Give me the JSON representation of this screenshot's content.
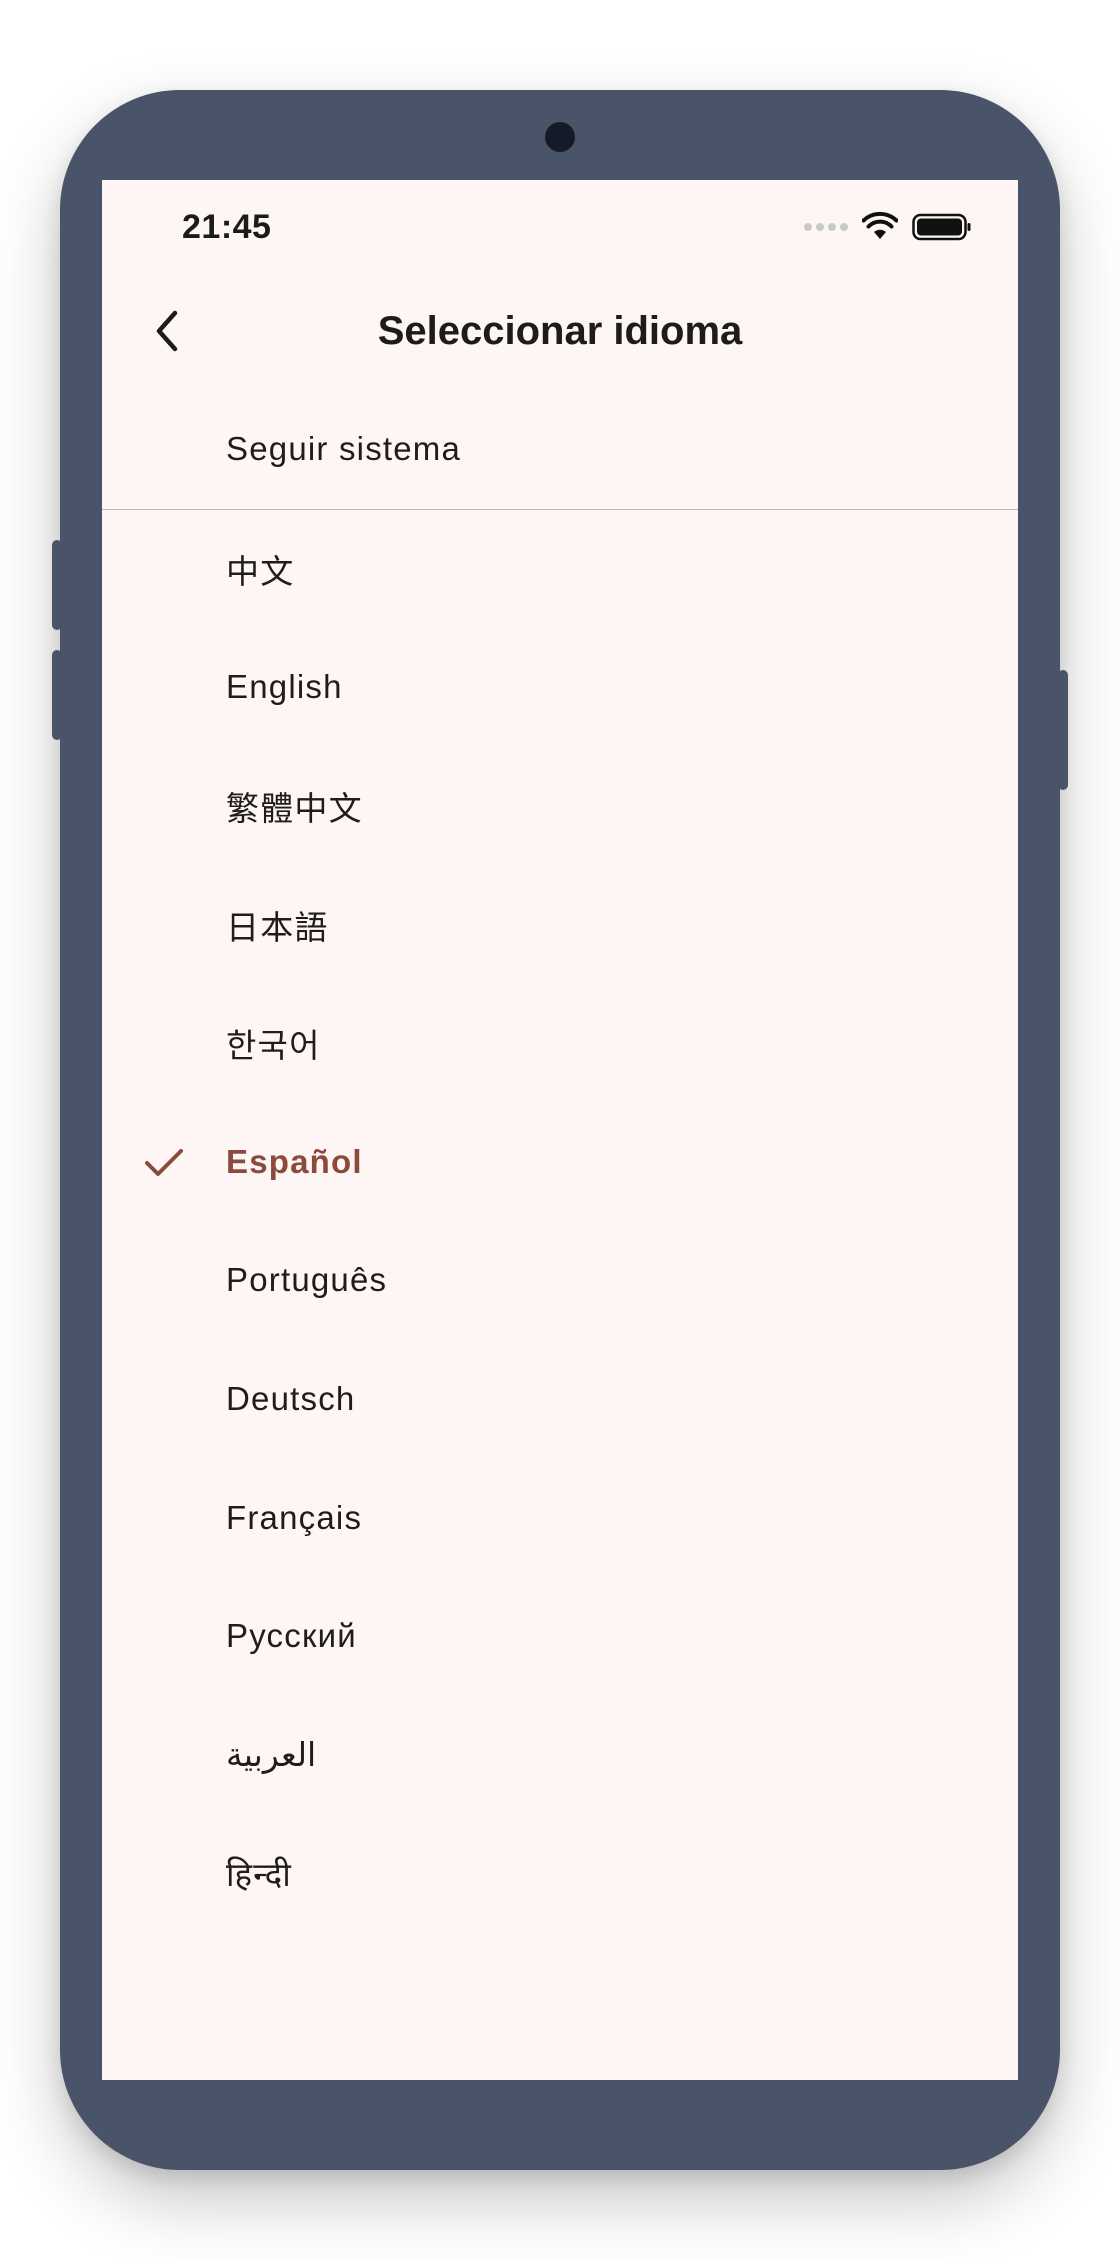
{
  "status_bar": {
    "time": "21:45",
    "icons": [
      "signal-dots-icon",
      "wifi-icon",
      "battery-icon"
    ]
  },
  "app_bar": {
    "back_icon": "chevron-left-icon",
    "title": "Seleccionar idioma"
  },
  "system_option": {
    "label": "Seguir sistema"
  },
  "languages": [
    {
      "label": "中文",
      "selected": false
    },
    {
      "label": "English",
      "selected": false
    },
    {
      "label": "繁體中文",
      "selected": false
    },
    {
      "label": "日本語",
      "selected": false
    },
    {
      "label": "한국어",
      "selected": false
    },
    {
      "label": "Español",
      "selected": true
    },
    {
      "label": "Português",
      "selected": false
    },
    {
      "label": "Deutsch",
      "selected": false
    },
    {
      "label": "Français",
      "selected": false
    },
    {
      "label": "Русский",
      "selected": false
    },
    {
      "label": "العربية",
      "selected": false
    },
    {
      "label": "हिन्दी",
      "selected": false
    }
  ],
  "colors": {
    "screen_background": "#fdf6f4",
    "accent": "#8b4a3c",
    "device_frame": "#4a5468",
    "text": "#211c1c"
  }
}
